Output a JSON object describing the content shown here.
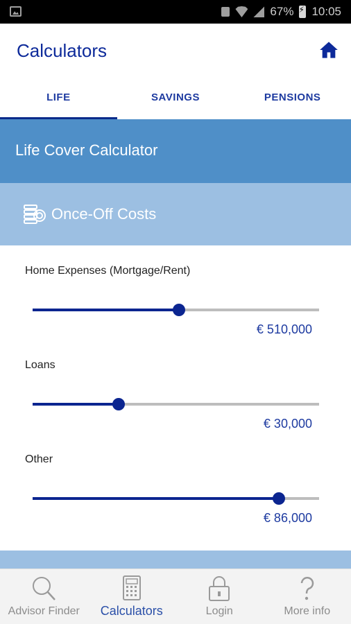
{
  "status_bar": {
    "battery": "67%",
    "time": "10:05"
  },
  "app_bar": {
    "title": "Calculators",
    "home_icon": "home-icon"
  },
  "tabs": [
    {
      "label": "LIFE",
      "active": true
    },
    {
      "label": "SAVINGS",
      "active": false
    },
    {
      "label": "PENSIONS",
      "active": false
    }
  ],
  "life_header": {
    "title": "Life Cover Calculator"
  },
  "section": {
    "icon": "coins-icon",
    "title": "Once-Off Costs"
  },
  "sliders": [
    {
      "label": "Home Expenses (Mortgage/Rent)",
      "value": "€ 510,000",
      "level": 0.51
    },
    {
      "label": "Loans",
      "value": "€ 30,000",
      "level": 0.3
    },
    {
      "label": "Other",
      "value": "€ 86,000",
      "level": 0.86
    }
  ],
  "bottom_nav": [
    {
      "label": "Advisor Finder",
      "icon": "search-icon",
      "active": false
    },
    {
      "label": "Calculators",
      "icon": "calculator-icon",
      "active": true
    },
    {
      "label": "Login",
      "icon": "lock-icon",
      "active": false
    },
    {
      "label": "More info",
      "icon": "question-icon",
      "active": false
    }
  ],
  "colors": {
    "brand": "#0d2a9a",
    "header_blue": "#4f8fc8",
    "section_blue": "#9cbfe2",
    "slider": "#0b2590"
  }
}
